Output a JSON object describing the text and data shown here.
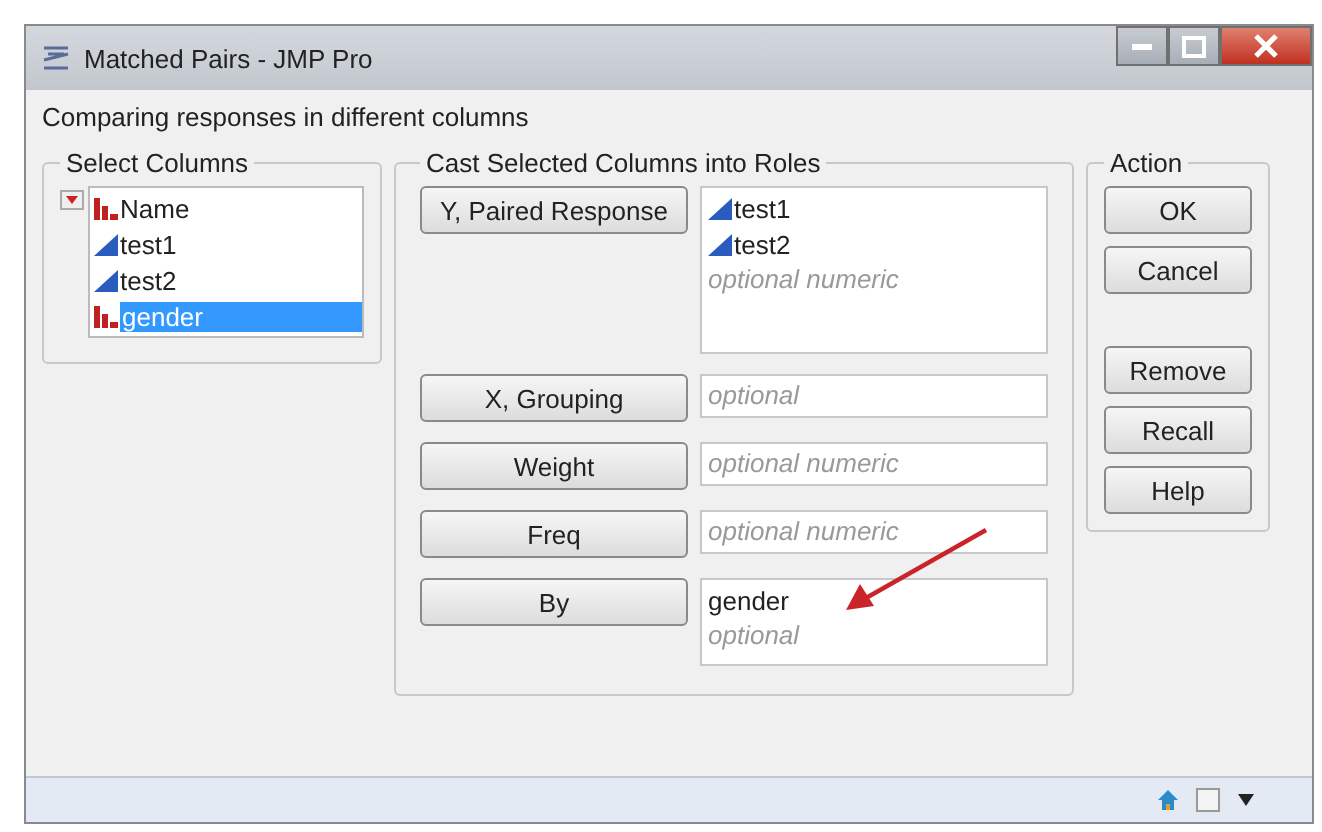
{
  "window": {
    "title": "Matched Pairs - JMP Pro"
  },
  "description": "Comparing responses in different columns",
  "select_columns": {
    "title": "Select Columns",
    "columns": [
      {
        "name": "Name",
        "kind": "nominal",
        "selected": false
      },
      {
        "name": "test1",
        "kind": "continuous",
        "selected": false
      },
      {
        "name": "test2",
        "kind": "continuous",
        "selected": false
      },
      {
        "name": "gender",
        "kind": "nominal",
        "selected": true
      }
    ]
  },
  "roles": {
    "title": "Cast Selected Columns into Roles",
    "rows": [
      {
        "button": "Y, Paired Response",
        "items": [
          {
            "name": "test1",
            "kind": "continuous"
          },
          {
            "name": "test2",
            "kind": "continuous"
          }
        ],
        "placeholder": "optional numeric"
      },
      {
        "button": "X, Grouping",
        "items": [],
        "placeholder": "optional"
      },
      {
        "button": "Weight",
        "items": [],
        "placeholder": "optional numeric"
      },
      {
        "button": "Freq",
        "items": [],
        "placeholder": "optional numeric"
      },
      {
        "button": "By",
        "items": [
          {
            "name": "gender",
            "kind": "plain"
          }
        ],
        "placeholder": "optional"
      }
    ]
  },
  "action": {
    "title": "Action",
    "buttons": [
      {
        "label": "OK"
      },
      {
        "label": "Cancel"
      },
      {
        "label": "Remove"
      },
      {
        "label": "Recall"
      },
      {
        "label": "Help"
      }
    ]
  }
}
